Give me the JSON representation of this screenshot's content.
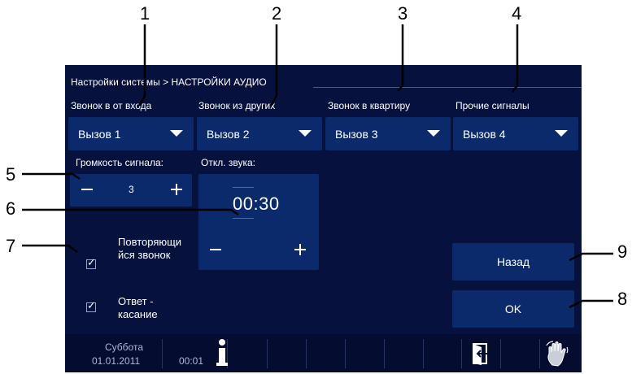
{
  "callouts": [
    "1",
    "2",
    "3",
    "4",
    "5",
    "6",
    "7",
    "8",
    "9"
  ],
  "breadcrumb": "Настройки системы > НАСТРОЙКИ АУДИО",
  "columns": [
    {
      "label": "Звонок в от входа",
      "value": "Вызов 1"
    },
    {
      "label": "Звонок из других",
      "value": "Вызов 2"
    },
    {
      "label": "Звонок в квартиру",
      "value": "Вызов 3"
    },
    {
      "label": "Прочие сигналы",
      "value": "Вызов 4"
    }
  ],
  "volume": {
    "label": "Громкость сигнала:",
    "value": "3"
  },
  "mute": {
    "label": "Откл. звука:",
    "value": "00:30"
  },
  "options": [
    {
      "label_line1": "Повторяющи",
      "label_line2": "йся звонок",
      "checked": true
    },
    {
      "label_line1": "Ответ -",
      "label_line2": "касание",
      "checked": true
    }
  ],
  "buttons": {
    "back": "Назад",
    "ok": "OK"
  },
  "status": {
    "day": "Суббота",
    "date": "01.01.2011",
    "time": "00:01"
  },
  "icons": [
    "info-icon",
    "exit-door-icon",
    "hand-touch-icon",
    "dropdown-arrow-icon"
  ],
  "colors": {
    "screen_bg": "#06113e",
    "control_bg": "#0b2a6b",
    "statusbar_bg": "#040c30",
    "text": "#ffffff"
  }
}
